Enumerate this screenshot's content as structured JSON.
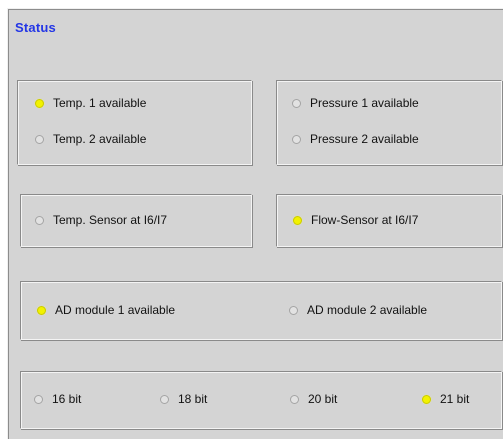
{
  "status": {
    "title": "Status",
    "colors": {
      "led_on": "#f2f200",
      "led_off": "#e2e2e2",
      "title": "#2336e6"
    },
    "groups": [
      {
        "items": [
          {
            "label": "Temp. 1 available",
            "state": "on"
          },
          {
            "label": "Temp. 2 available",
            "state": "off"
          }
        ]
      },
      {
        "items": [
          {
            "label": "Pressure 1 available",
            "state": "off"
          },
          {
            "label": "Pressure 2 available",
            "state": "off"
          }
        ]
      },
      {
        "items": [
          {
            "label": "Temp. Sensor at I6/I7",
            "state": "off"
          }
        ]
      },
      {
        "items": [
          {
            "label": "Flow-Sensor at I6/I7",
            "state": "on"
          }
        ]
      },
      {
        "items": [
          {
            "label": "AD module 1 available",
            "state": "on"
          },
          {
            "label": "AD module 2 available",
            "state": "off"
          }
        ]
      },
      {
        "items": [
          {
            "label": "16 bit",
            "state": "off"
          },
          {
            "label": "18 bit",
            "state": "off"
          },
          {
            "label": "20 bit",
            "state": "off"
          },
          {
            "label": "21 bit",
            "state": "on"
          }
        ]
      }
    ]
  }
}
